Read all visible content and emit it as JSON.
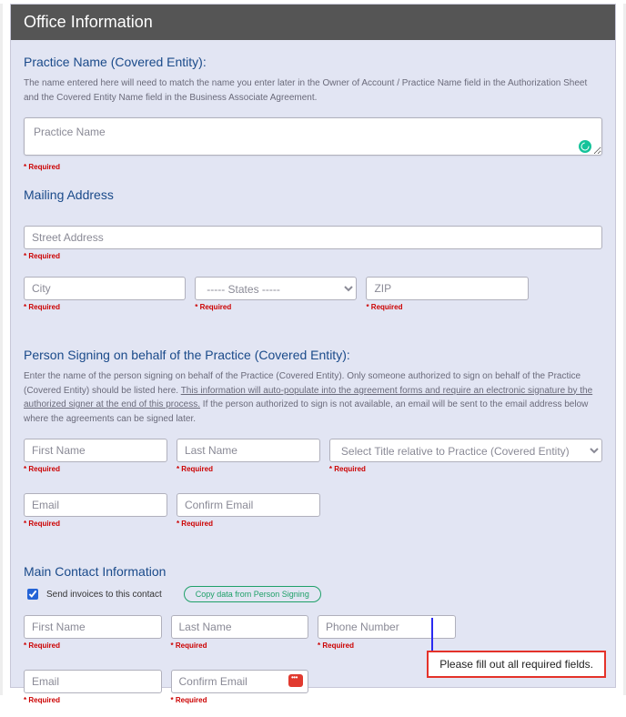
{
  "header": {
    "title": "Office Information"
  },
  "practice": {
    "title": "Practice Name (Covered Entity):",
    "desc": "The name entered here will need to match the name you enter later in the Owner of Account / Practice Name field in the Authorization Sheet and the Covered Entity Name field in the Business Associate Agreement.",
    "placeholder": "Practice Name",
    "required": "* Required"
  },
  "mailing": {
    "title": "Mailing Address",
    "street_ph": "Street Address",
    "city_ph": "City",
    "state_ph": "----- States -----",
    "zip_ph": "ZIP",
    "required": "* Required"
  },
  "signer": {
    "title": "Person Signing on behalf of the Practice (Covered Entity):",
    "desc_a": "Enter the name of the person signing on behalf of the Practice (Covered Entity). Only someone authorized to sign on behalf of the Practice (Covered Entity) should be listed here. ",
    "desc_u": "This information will auto-populate into the agreement forms and require an electronic signature by the authorized signer at the end of this process.",
    "desc_b": " If the person authorized to sign is not available, an email will be sent to the email address below where the agreements can be signed later.",
    "first_ph": "First Name",
    "last_ph": "Last Name",
    "title_ph": "Select Title relative to Practice (Covered Entity)",
    "email_ph": "Email",
    "confirm_ph": "Confirm Email",
    "required": "* Required"
  },
  "contact": {
    "title": "Main Contact Information",
    "checkbox_label": "Send invoices to this contact",
    "copy_btn": "Copy data from Person Signing",
    "first_ph": "First Name",
    "last_ph": "Last Name",
    "phone_ph": "Phone Number",
    "email_ph": "Email",
    "confirm_ph": "Confirm Email",
    "required": "* Required"
  },
  "callout": {
    "text": "Please fill out all required fields."
  }
}
